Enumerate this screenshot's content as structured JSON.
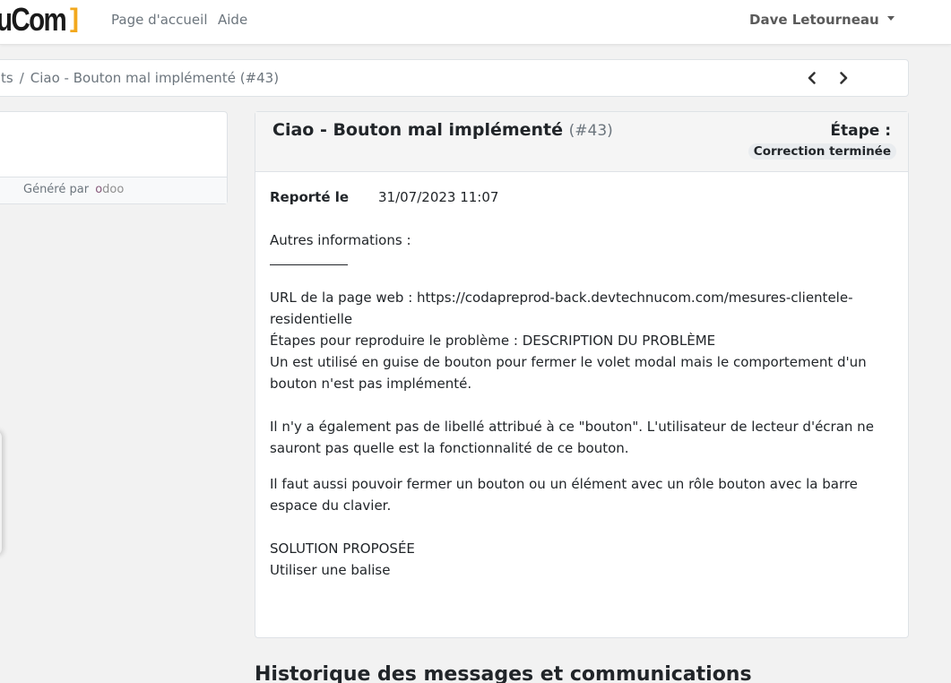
{
  "navbar": {
    "brand_text": "uCom",
    "brand_bracket": "]",
    "links": [
      "Page d'accueil",
      "Aide"
    ],
    "user": "Dave Letourneau"
  },
  "breadcrumb": {
    "parent": "ts",
    "separator": "/",
    "current": "Ciao - Bouton mal implémenté (#43)"
  },
  "sidebar": {
    "generated_by": "Généré par",
    "odoo_logo": "odoo"
  },
  "task": {
    "title": "Ciao - Bouton mal implémenté",
    "ref": "(#43)",
    "stage_label": "Étape :",
    "stage_value": "Correction terminée",
    "reported_label": "Reporté le",
    "reported_value": "31/07/2023 11:07",
    "description": {
      "other_info": "Autres informations :",
      "url_line": "URL de la page web : https://codapreprod-back.devtechnucom.com/mesures-clientele-residentielle",
      "steps_line": "Étapes pour reproduire le problème : DESCRIPTION DU PROBLÈME",
      "issue_line": "Un est utilisé en guise de bouton pour fermer le volet modal mais le comportement d'un bouton n'est pas implémenté.",
      "label_line": "Il n'y a également pas de libellé attribué à ce \"bouton\". L'utilisateur de lecteur d'écran ne sauront pas quelle est la fonctionnalité de ce bouton.",
      "keyboard_line": "Il faut aussi pouvoir fermer un bouton ou un élément avec un rôle bouton avec la barre espace du clavier.",
      "solution_heading": "SOLUTION PROPOSÉE",
      "solution_line": "Utiliser une balise"
    }
  },
  "history": {
    "title": "Historique des messages et communications"
  },
  "colors": {
    "brand_accent": "#f2a81d",
    "odoo_purple": "#875a7b",
    "stage_badge_bg": "#e9ecef"
  }
}
